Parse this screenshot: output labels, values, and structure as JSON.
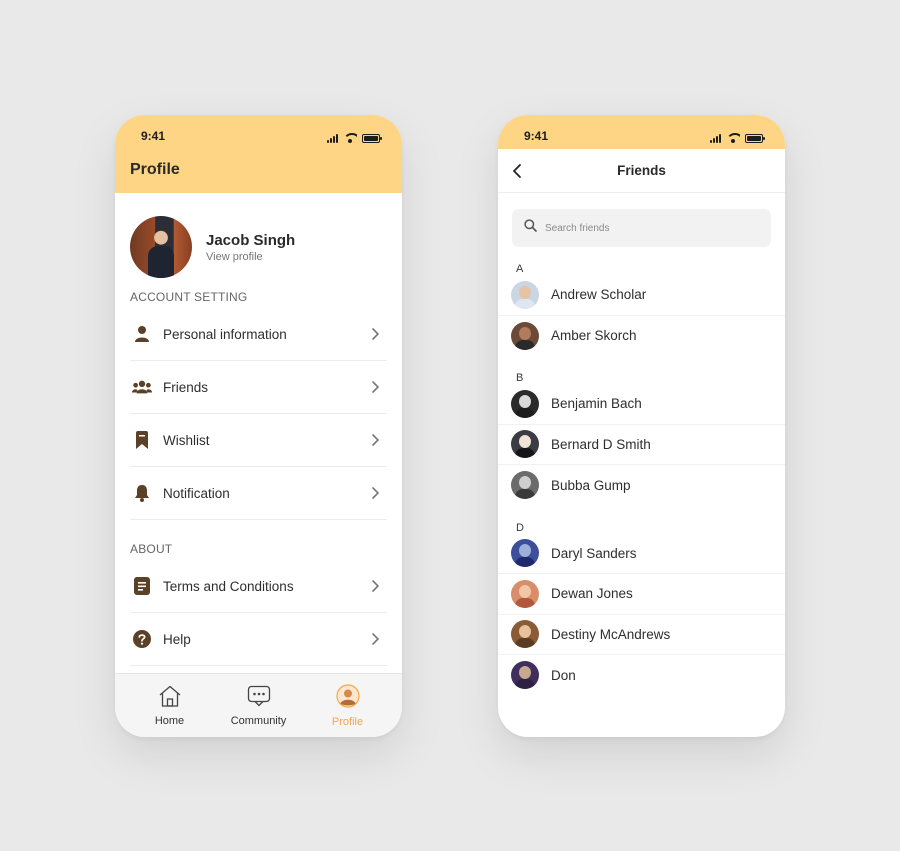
{
  "colors": {
    "header_yellow": "#fed584",
    "icon_brown": "#5a4127",
    "active_tab": "#f0a84a",
    "background": "#e9e9e9"
  },
  "profile_screen": {
    "status_time": "9:41",
    "title": "Profile",
    "user": {
      "name": "Jacob Singh",
      "subtitle": "View profile"
    },
    "account_section_label": "ACCOUNT SETTING",
    "account_items": [
      {
        "label": "Personal information",
        "icon": "person-icon"
      },
      {
        "label": "Friends",
        "icon": "group-icon"
      },
      {
        "label": "Wishlist",
        "icon": "bookmark-icon"
      },
      {
        "label": "Notification",
        "icon": "bell-icon"
      }
    ],
    "about_section_label": "ABOUT",
    "about_items": [
      {
        "label": "Terms and Conditions",
        "icon": "document-icon"
      },
      {
        "label": "Help",
        "icon": "help-icon"
      }
    ],
    "tabs": [
      {
        "label": "Home",
        "icon": "home-icon",
        "active": false
      },
      {
        "label": "Community",
        "icon": "chat-icon",
        "active": false
      },
      {
        "label": "Profile",
        "icon": "profile-icon",
        "active": true
      }
    ]
  },
  "friends_screen": {
    "status_time": "9:41",
    "title": "Friends",
    "search": {
      "placeholder": "Search friends",
      "value": ""
    },
    "groups": [
      {
        "letter": "A",
        "friends": [
          {
            "name": "Andrew Scholar",
            "skin": "#e6c3a3",
            "shirt": "#dfe6ef",
            "bg": "#c9d6e3"
          },
          {
            "name": "Amber Skorch",
            "skin": "#b07c5b",
            "shirt": "#2a2a2a",
            "bg": "#6b4a3a"
          }
        ]
      },
      {
        "letter": "B",
        "friends": [
          {
            "name": "Benjamin Bach",
            "skin": "#d9d9d9",
            "shirt": "#1d1d1d",
            "bg": "#2a2a2a"
          },
          {
            "name": "Bernard D Smith",
            "skin": "#f0e3d6",
            "shirt": "#15151a",
            "bg": "#3b3b44"
          },
          {
            "name": "Bubba Gump",
            "skin": "#cfcfcf",
            "shirt": "#3a3a3a",
            "bg": "#6b6b6b"
          }
        ]
      },
      {
        "letter": "D",
        "friends": [
          {
            "name": "Daryl Sanders",
            "skin": "#9fb0d8",
            "shirt": "#1e2a6b",
            "bg": "#3c4f9a"
          },
          {
            "name": "Dewan Jones",
            "skin": "#f1c7a7",
            "shirt": "#b2583d",
            "bg": "#d88e6a"
          },
          {
            "name": "Destiny McAndrews",
            "skin": "#e5c29b",
            "shirt": "#5a3b24",
            "bg": "#8a5b35"
          },
          {
            "name": "Don",
            "skin": "#c9a88f",
            "shirt": "#2d2244",
            "bg": "#3e2f5c"
          }
        ]
      }
    ]
  }
}
